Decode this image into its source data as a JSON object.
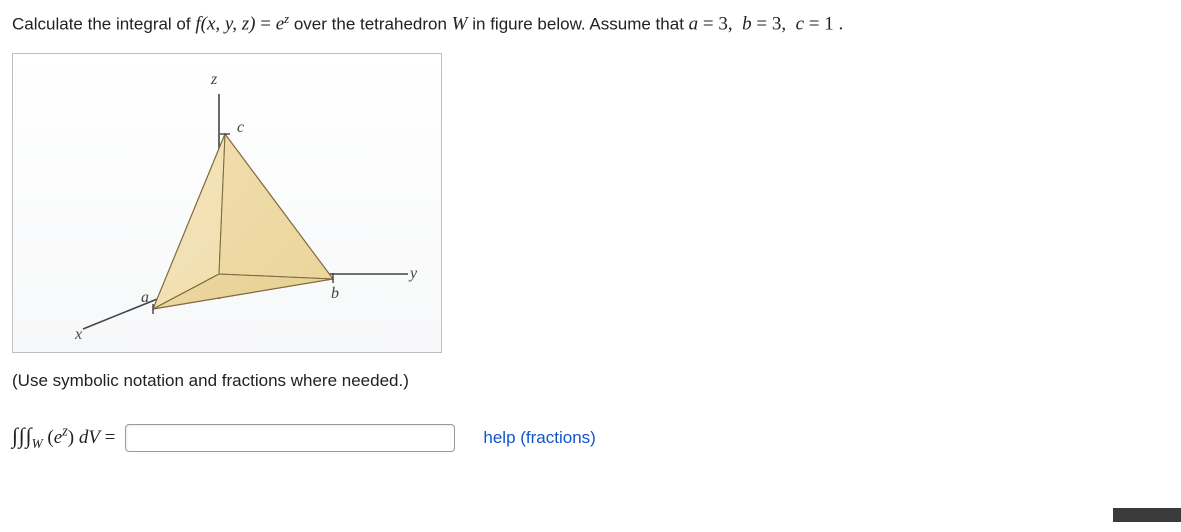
{
  "prompt": {
    "prefix": "Calculate the integral of ",
    "func_lhs": "f(x, y, z)",
    "equals1": " = ",
    "func_rhs_base": "e",
    "func_rhs_exp": "z",
    "mid1": " over the tetrahedron ",
    "W": "W",
    "mid2": " in figure below. Assume that ",
    "a_lhs": "a",
    "a_eq": " = ",
    "a_val": "3",
    "com1": ",  ",
    "b_lhs": "b",
    "b_eq": " = ",
    "b_val": "3",
    "com2": ",  ",
    "c_lhs": "c",
    "c_eq": " = ",
    "c_val": "1",
    "period": " ."
  },
  "figure": {
    "x": "x",
    "y": "y",
    "z": "z",
    "a": "a",
    "b": "b",
    "c": "c"
  },
  "instruction": "(Use symbolic notation and fractions where needed.)",
  "answer": {
    "int": "∫",
    "sub": "W",
    "open": "(",
    "base": "e",
    "exp": "z",
    "close": ")",
    "dV": " dV",
    "equals": " = ",
    "placeholder": ""
  },
  "help_text": "help (fractions)"
}
